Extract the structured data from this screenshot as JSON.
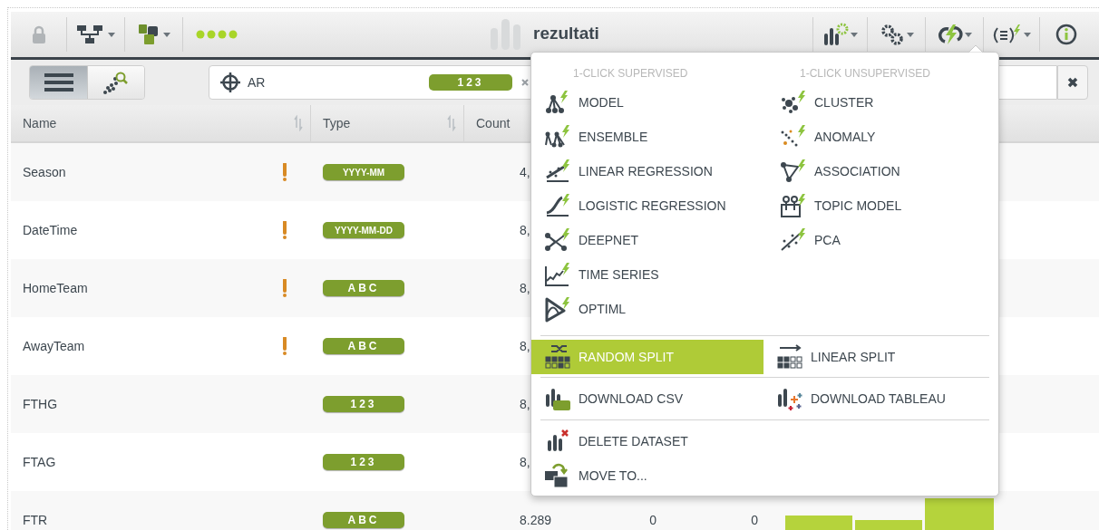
{
  "toolbar": {
    "title": "rezultati"
  },
  "view_toggle": [
    {
      "selected": true
    },
    {
      "selected": false
    }
  ],
  "filter": {
    "value": "AR",
    "badge": "123"
  },
  "table": {
    "columns": [
      "Name",
      "Type",
      "Count"
    ],
    "rows": [
      {
        "name": "Season",
        "warning": true,
        "type": "YYYY-MM",
        "count": "4,"
      },
      {
        "name": "DateTime",
        "warning": true,
        "type": "YYYY-MM-DD",
        "count": "8,"
      },
      {
        "name": "HomeTeam",
        "warning": true,
        "type": "ABC",
        "count": "8,"
      },
      {
        "name": "AwayTeam",
        "warning": true,
        "type": "ABC",
        "count": "8,"
      },
      {
        "name": "FTHG",
        "warning": false,
        "type": "123",
        "count": "8,"
      },
      {
        "name": "FTAG",
        "warning": false,
        "type": "123",
        "count": "8,"
      },
      {
        "name": "FTR",
        "warning": false,
        "type": "ABC",
        "count": "8.289",
        "column_4": "0",
        "column_5": "0"
      }
    ]
  },
  "menu": {
    "headers": [
      "1-CLICK SUPERVISED",
      "1-CLICK UNSUPERVISED"
    ],
    "supervised": [
      "MODEL",
      "ENSEMBLE",
      "LINEAR REGRESSION",
      "LOGISTIC REGRESSION",
      "DEEPNET",
      "TIME SERIES",
      "OPTIML"
    ],
    "unsupervised": [
      "CLUSTER",
      "ANOMALY",
      "ASSOCIATION",
      "TOPIC MODEL",
      "PCA"
    ],
    "split": [
      {
        "label": "RANDOM SPLIT",
        "selected": true
      },
      {
        "label": "LINEAR SPLIT",
        "selected": false
      }
    ],
    "download": [
      "DOWNLOAD CSV",
      "DOWNLOAD TABLEAU"
    ],
    "manage": [
      "DELETE DATASET",
      "MOVE TO..."
    ]
  }
}
